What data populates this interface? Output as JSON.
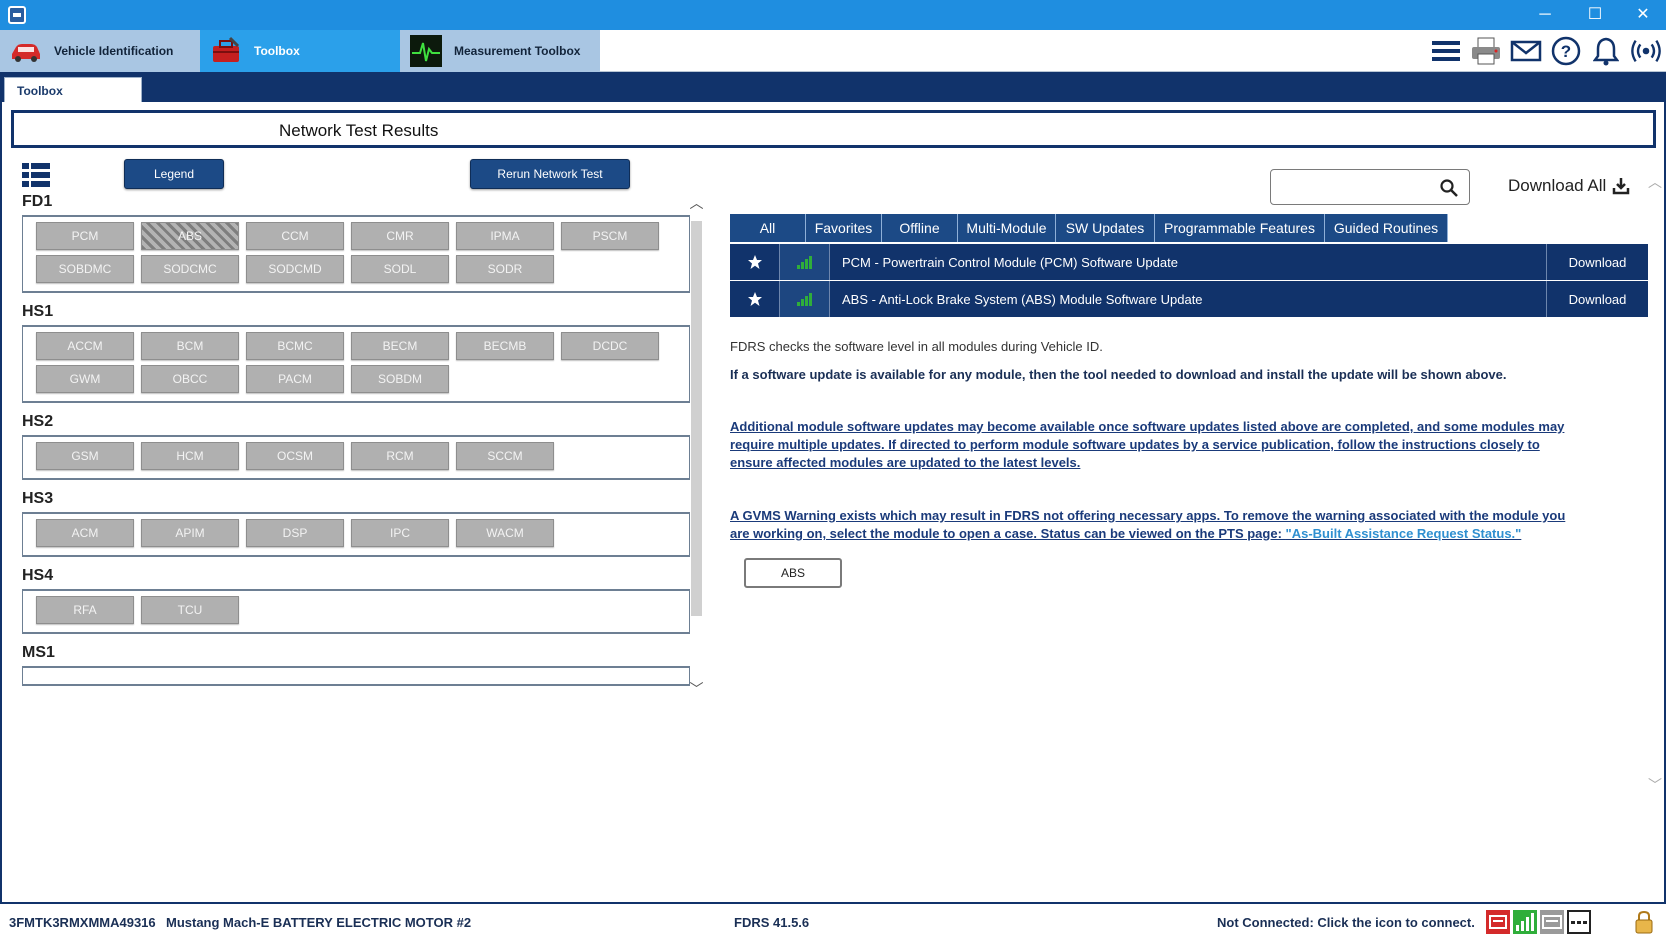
{
  "window": {
    "minimize": "─",
    "maximize": "☐",
    "close": "✕"
  },
  "tabs": [
    {
      "label": "Vehicle Identification"
    },
    {
      "label": "Toolbox"
    },
    {
      "label": "Measurement Toolbox"
    }
  ],
  "subtab": "Toolbox",
  "header": "Network Test Results",
  "buttons": {
    "legend": "Legend",
    "rerun": "Rerun Network Test"
  },
  "networks": [
    {
      "name": "FD1",
      "modules": [
        "PCM",
        "ABS",
        "CCM",
        "CMR",
        "IPMA",
        "PSCM",
        "SOBDMC",
        "SODCMC",
        "SODCMD",
        "SODL",
        "SODR"
      ]
    },
    {
      "name": "HS1",
      "modules": [
        "ACCM",
        "BCM",
        "BCMC",
        "BECM",
        "BECMB",
        "DCDC",
        "GWM",
        "OBCC",
        "PACM",
        "SOBDM"
      ]
    },
    {
      "name": "HS2",
      "modules": [
        "GSM",
        "HCM",
        "OCSM",
        "RCM",
        "SCCM"
      ]
    },
    {
      "name": "HS3",
      "modules": [
        "ACM",
        "APIM",
        "DSP",
        "IPC",
        "WACM"
      ]
    },
    {
      "name": "HS4",
      "modules": [
        "RFA",
        "TCU"
      ]
    },
    {
      "name": "MS1",
      "modules": []
    }
  ],
  "download_all": "Download All",
  "filters": [
    "All",
    "Favorites",
    "Offline",
    "Multi-Module",
    "SW Updates",
    "Programmable Features",
    "Guided Routines"
  ],
  "updates": [
    {
      "title": "PCM - Powertrain Control Module (PCM) Software Update",
      "action": "Download"
    },
    {
      "title": "ABS - Anti-Lock Brake System (ABS) Module Software Update",
      "action": "Download"
    }
  ],
  "messages": {
    "m1": "FDRS checks the software level in all modules during Vehicle ID.",
    "m2": "If a software update is available for any module, then the tool needed to download and install the update will be shown above.",
    "m3_line1": "Additional module software updates may become available once software updates listed above are completed, and some modules may",
    "m3_line2": "require multiple updates. If directed to perform module software updates by a service publication, follow the instructions closely to",
    "m3_line3": "ensure affected modules are updated to the latest levels.",
    "m4_line1": "A GVMS Warning exists which may result in FDRS not offering necessary apps. To remove the warning associated with the module you",
    "m4_line2": "are working on, select the module to open a case. Status can be viewed on the PTS page: ",
    "m4_link": "\"As-Built Assistance Request Status.\""
  },
  "gvms_module": "ABS",
  "status": {
    "vin": "3FMTK3RMXMMA49316",
    "vehicle": "Mustang Mach-E BATTERY ELECTRIC MOTOR #2",
    "version": "FDRS 41.5.6",
    "connection": "Not Connected: Click the icon to connect."
  },
  "colors": {
    "navy": "#11336b",
    "title_blue": "#1f8ee0",
    "module_gray": "#b0b0b0",
    "signal_green": "#2fae3a"
  }
}
